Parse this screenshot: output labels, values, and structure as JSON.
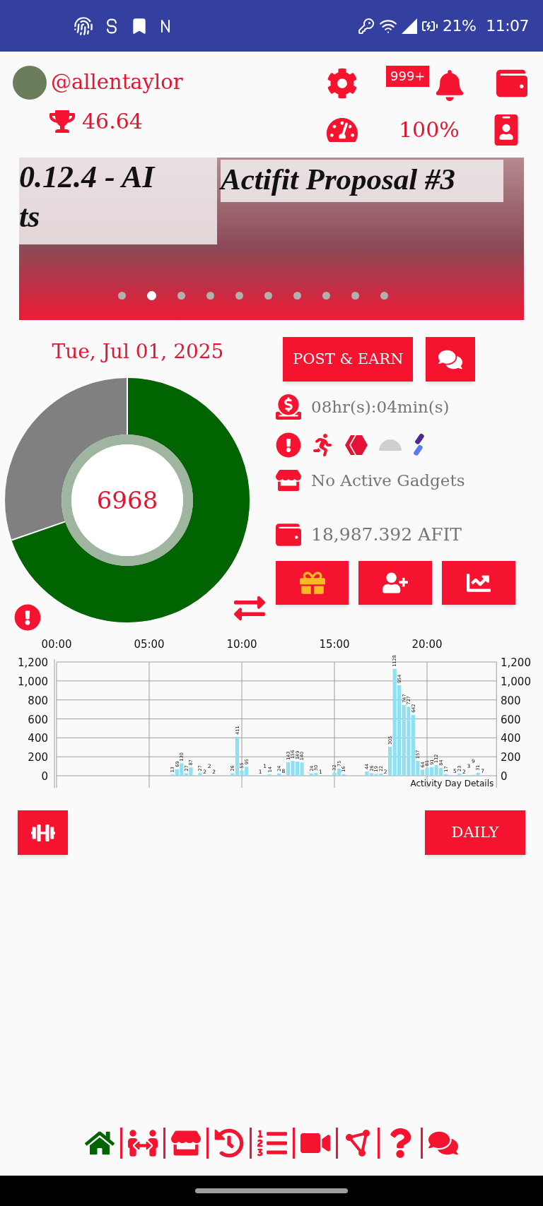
{
  "status_bar": {
    "battery": "21%",
    "time": "11:07"
  },
  "profile": {
    "username": "@allentaylor",
    "score": "46.64",
    "notifications": "999+",
    "percent": "100%"
  },
  "banner": {
    "captions": [
      {
        "lines": [
          "0.12.4 - AI",
          "ts"
        ]
      },
      {
        "lines": [
          "Actifit Proposal #3"
        ]
      }
    ],
    "dots": [
      {
        "selected": false
      },
      {
        "selected": true
      },
      {
        "selected": false
      },
      {
        "selected": false
      },
      {
        "selected": false
      },
      {
        "selected": false
      },
      {
        "selected": false
      },
      {
        "selected": false
      },
      {
        "selected": false
      },
      {
        "selected": false
      }
    ]
  },
  "summary": {
    "date": "Tue, Jul 01, 2025",
    "donut": {
      "center": "6968",
      "level": 0.697
    },
    "post_button": "POST & EARN",
    "timer": "08hr(s):04min(s)",
    "gadgets": "No Active Gadgets",
    "balance": "18,987.392 AFIT"
  },
  "activity": {
    "chart_data": {
      "type": "bar",
      "title": "Activity Day Details",
      "data_labels": true,
      "grid": true,
      "xlim": [
        0,
        23.75
      ],
      "ylim": [
        0,
        1200
      ],
      "xticks": [
        {
          "value": 0,
          "label": "00:00"
        },
        {
          "value": 5,
          "label": "05:00"
        },
        {
          "value": 10,
          "label": "10:00"
        },
        {
          "value": 15,
          "label": "15:00"
        },
        {
          "value": 20,
          "label": "20:00"
        }
      ],
      "yticks": [
        {
          "value": 0,
          "label": "0"
        },
        {
          "value": 200,
          "label": "200"
        },
        {
          "value": 400,
          "label": "400"
        },
        {
          "value": 600,
          "label": "600"
        },
        {
          "value": 800,
          "label": "800"
        },
        {
          "value": 1000,
          "label": "1,000"
        },
        {
          "value": 1200,
          "label": "1,200"
        }
      ],
      "x": [
        6.25,
        6.5,
        6.75,
        7,
        7.25,
        7.75,
        8,
        8.25,
        8.5,
        9.5,
        9.75,
        10,
        10.25,
        11,
        11.25,
        11.5,
        12,
        12.25,
        12.5,
        12.75,
        13,
        13.25,
        13.75,
        14,
        14.25,
        15,
        15.25,
        15.5,
        16.75,
        17,
        17.25,
        17.5,
        17.75,
        18,
        18.25,
        18.5,
        18.75,
        19,
        19.25,
        19.5,
        19.75,
        20,
        20.25,
        20.5,
        20.75,
        21,
        21.5,
        21.75,
        22,
        22.25,
        22.5,
        22.75,
        23
      ],
      "series": [
        {
          "color": "#8fe0f2",
          "values": [
            13,
            69,
            130,
            27,
            87,
            27,
            2,
            2,
            2,
            26,
            411,
            55,
            95,
            1,
            1,
            14,
            24,
            8,
            143,
            156,
            149,
            140,
            24,
            30,
            1,
            32,
            75,
            16,
            44,
            26,
            19,
            22,
            2,
            305,
            1128,
            954,
            747,
            727,
            642,
            157,
            64,
            81,
            91,
            112,
            84,
            17,
            5,
            23,
            2,
            3,
            9,
            31,
            7
          ]
        }
      ]
    },
    "right_yticks": [
      "1,200",
      "1,000",
      "800",
      "600",
      "400",
      "200",
      "0"
    ]
  },
  "buttons": {
    "daily": "DAILY"
  },
  "nav": [
    {
      "selected": true
    },
    {
      "selected": false
    },
    {
      "selected": false
    },
    {
      "selected": false
    },
    {
      "selected": false
    },
    {
      "selected": false
    },
    {
      "selected": false
    },
    {
      "selected": false
    },
    {
      "selected": false
    }
  ]
}
